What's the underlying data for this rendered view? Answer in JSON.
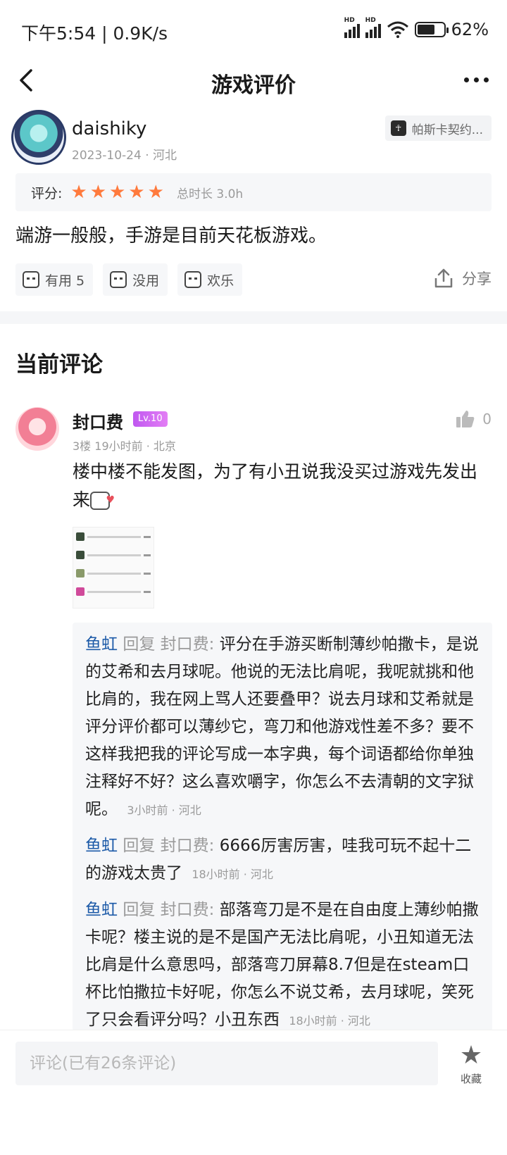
{
  "status_bar": {
    "time": "下午5:54 | 0.9K/s",
    "battery_pct": "62%",
    "signal_label": "HD"
  },
  "header": {
    "title": "游戏评价"
  },
  "review": {
    "author": "daishiky",
    "meta": "2023-10-24 · 河北",
    "game_badge": "帕斯卡契约...",
    "rating_label": "评分:",
    "stars": 5,
    "playtime": "总时长 3.0h",
    "text": "端游一般般，手游是目前天花板游戏。",
    "reactions": [
      {
        "label": "有用 5"
      },
      {
        "label": "没用"
      },
      {
        "label": "欢乐"
      }
    ],
    "share_label": "分享"
  },
  "section_title": "当前评论",
  "comment": {
    "name": "封口费",
    "level": "Lv.10",
    "meta": "3楼 19小时前 · 北京",
    "likes": "0",
    "text": "楼中楼不能发图，为了有小丑说我没买过游戏先发出来",
    "replies": [
      {
        "user": "鱼虹",
        "reply_word": "回复",
        "target": "封口费:",
        "text": "评分在手游买断制薄纱帕撒卡，是说的艾希和去月球呢。他说的无法比肩呢，我呢就挑和他比肩的，我在网上骂人还要叠甲？说去月球和艾希就是评分评价都可以薄纱它，弯刀和他游戏性差不多？要不这样我把我的评论写成一本字典，每个词语都给你单独注释好不好？这么喜欢嚼字，你怎么不去清朝的文字狱呢。",
        "time": "3小时前 · 河北"
      },
      {
        "user": "鱼虹",
        "reply_word": "回复",
        "target": "封口费:",
        "text": "6666厉害厉害，哇我可玩不起十二的游戏太贵了",
        "time": "18小时前 · 河北"
      },
      {
        "user": "鱼虹",
        "reply_word": "回复",
        "target": "封口费:",
        "text": "部落弯刀是不是在自由度上薄纱帕撒卡呢？楼主说的是不是国产无法比肩呢，小丑知道无法比肩是什么意思吗，部落弯刀屏幕8.7但是在steam口杯比怕撒拉卡好呢，你怎么不说艾希，去月球呢，笑死了只会看评分吗？小丑东西",
        "time": "18小时前 · 河北"
      }
    ]
  },
  "bottom_bar": {
    "input_placeholder": "评论(已有26条评论)",
    "fav_label": "收藏"
  },
  "colors": {
    "star": "#ff7a3d",
    "reply_user": "#1c5aa8",
    "level_badge": "#c058f0"
  }
}
